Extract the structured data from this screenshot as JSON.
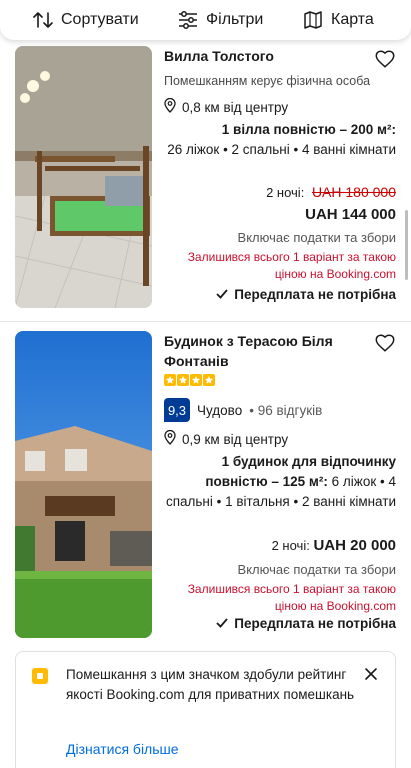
{
  "toolbar": {
    "sort_label": "Сортувати",
    "filter_label": "Фільтри",
    "map_label": "Карта"
  },
  "listings": [
    {
      "title": "Вилла Толстого",
      "managed_by": "Помешканням керує фізична особа",
      "distance": "0,8 км від центру",
      "unit_bold": "1 вілла повністю – 200 м²:",
      "unit_rest": "26 ліжок • 2 спальні • 4 ванні кімнати",
      "nights": "2 ночі:",
      "old_price": "UAH 180 000",
      "price": "UAH 144 000",
      "taxes": "Включає податки та збори",
      "availability": "Залишився всього 1 варіант за такою ціною на Booking.com",
      "prepay": "Передплата не потрібна"
    },
    {
      "title": "Будинок з Терасою Біля Фонтанів",
      "stars": 4,
      "score": "9,3",
      "score_word": "Чудово",
      "reviews": "96 відгуків",
      "distance": "0,9 км від центру",
      "unit_bold": "1 будинок для відпочинку повністю – 125 м²:",
      "unit_rest": "6 ліжок • 4 спальні • 1 вітальня • 2 ванні кімнати",
      "nights": "2 ночі:",
      "price": "UAH 20 000",
      "taxes": "Включає податки та збори",
      "availability": "Залишився всього 1 варіант за такою ціною на Booking.com",
      "prepay": "Передплата не потрібна"
    }
  ],
  "banner": {
    "text": "Помешкання з цим значком здобули рейтинг якості Booking.com для приватних помешкань",
    "link": "Дізнатися більше"
  },
  "colors": {
    "brand_blue": "#003b95",
    "link_blue": "#006ce4",
    "star_yellow": "#febb02",
    "urgency_red": "#c8102e"
  }
}
